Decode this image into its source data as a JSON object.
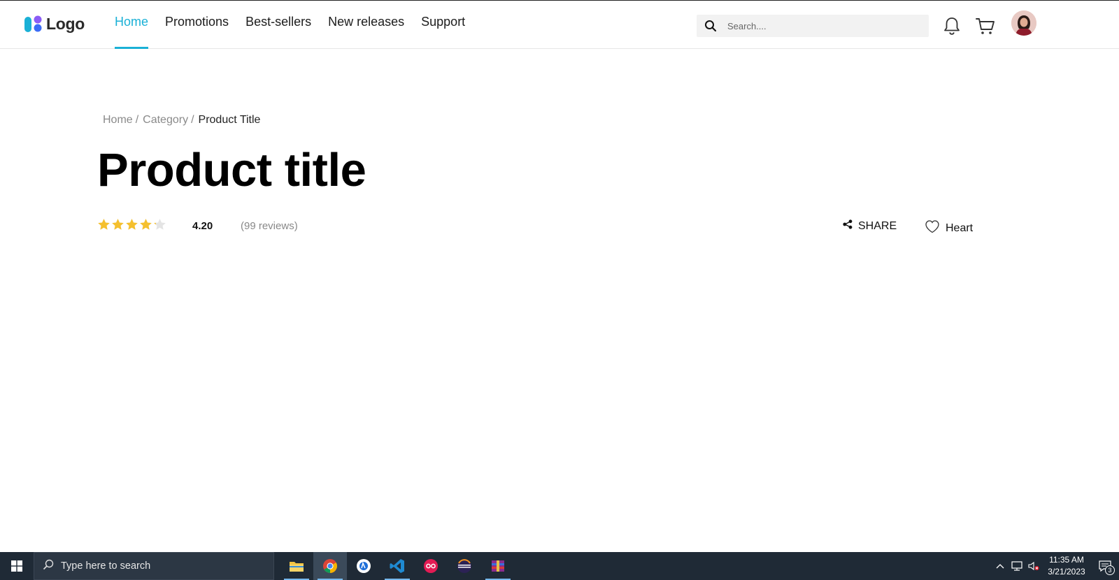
{
  "header": {
    "logo_text": "Logo",
    "nav": [
      {
        "label": "Home",
        "active": true
      },
      {
        "label": "Promotions",
        "active": false
      },
      {
        "label": "Best-sellers",
        "active": false
      },
      {
        "label": "New releases",
        "active": false
      },
      {
        "label": "Support",
        "active": false
      }
    ],
    "search": {
      "placeholder": "Search...."
    },
    "icons": [
      "search-icon",
      "bell-icon",
      "cart-icon",
      "avatar"
    ],
    "accent_color": "#1ab0d6"
  },
  "breadcrumb": {
    "items": [
      "Home",
      "Category",
      "Product Title"
    ],
    "separator": "/"
  },
  "product": {
    "title": "Product title",
    "rating": {
      "value": "4.20",
      "stars": 4.2,
      "max": 5,
      "star_color": "#f5c02e"
    },
    "reviews": "(99 reviews)",
    "share_label": "SHARE",
    "heart_label": "Heart"
  },
  "taskbar": {
    "search_text": "Type here to search",
    "apps": [
      {
        "name": "file-explorer-icon",
        "running": true,
        "active": false
      },
      {
        "name": "chrome-icon",
        "running": true,
        "active": true
      },
      {
        "name": "app-blue-circle-icon",
        "running": false,
        "active": false
      },
      {
        "name": "vscode-icon",
        "running": true,
        "active": false
      },
      {
        "name": "app-red-icon",
        "running": false,
        "active": false
      },
      {
        "name": "eclipse-icon",
        "running": false,
        "active": false
      },
      {
        "name": "winrar-icon",
        "running": true,
        "active": false
      }
    ],
    "time": "11:35 AM",
    "date": "3/21/2023",
    "notification_count": "3"
  }
}
